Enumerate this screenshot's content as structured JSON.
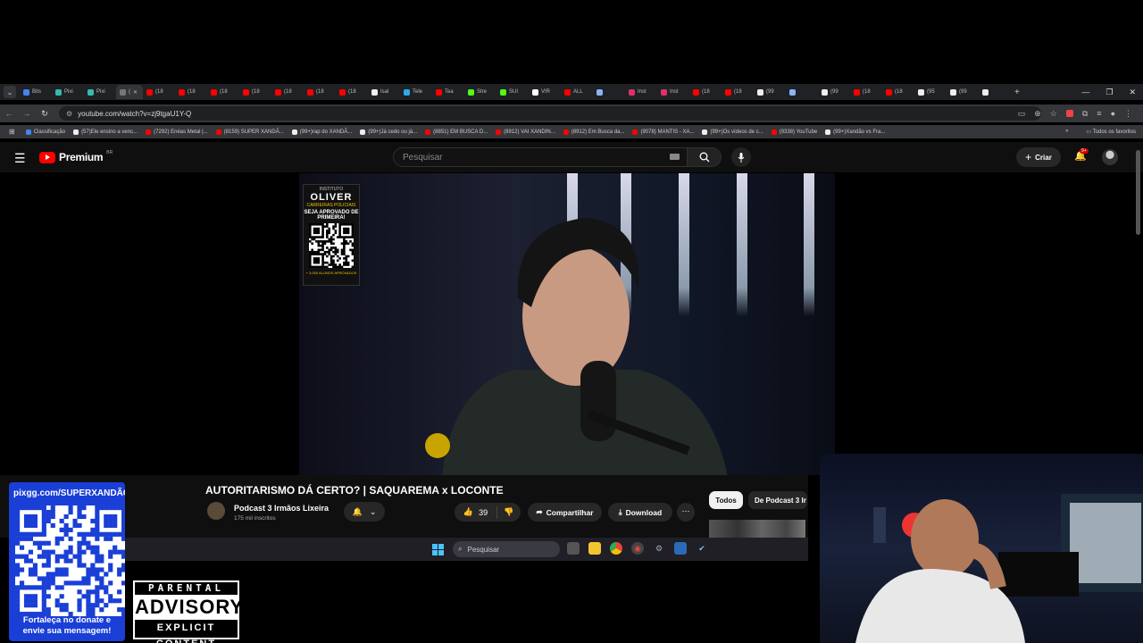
{
  "browser": {
    "tabs": [
      {
        "label": "Bits",
        "color": "#4285f4"
      },
      {
        "label": "Pixi",
        "color": "#32bcad"
      },
      {
        "label": "Pixi",
        "color": "#32bcad"
      },
      {
        "label": "(",
        "color": "#777777",
        "active": true
      },
      {
        "label": "(18",
        "color": "#ff0000"
      },
      {
        "label": "(18",
        "color": "#ff0000"
      },
      {
        "label": "(18",
        "color": "#ff0000"
      },
      {
        "label": "(18",
        "color": "#ff0000"
      },
      {
        "label": "(18",
        "color": "#ff0000"
      },
      {
        "label": "(18",
        "color": "#ff0000"
      },
      {
        "label": "(18",
        "color": "#ff0000"
      },
      {
        "label": "Isal",
        "color": "#eeeeee"
      },
      {
        "label": "Tele",
        "color": "#2aabee"
      },
      {
        "label": "Tea",
        "color": "#ff0000"
      },
      {
        "label": "Stre",
        "color": "#53fc18"
      },
      {
        "label": "SUI",
        "color": "#53fc18"
      },
      {
        "label": "VIR",
        "color": "#ffffff"
      },
      {
        "label": "ALL",
        "color": "#ff0000"
      },
      {
        "label": "",
        "color": "#8ab4f8"
      },
      {
        "label": "Inst",
        "color": "#e1306c"
      },
      {
        "label": "Inst",
        "color": "#e1306c"
      },
      {
        "label": "(18",
        "color": "#ff0000"
      },
      {
        "label": "(18",
        "color": "#ff0000"
      },
      {
        "label": "(99",
        "color": "#eeeeee"
      },
      {
        "label": "",
        "color": "#8ab4f8"
      },
      {
        "label": "(99",
        "color": "#eeeeee"
      },
      {
        "label": "(18",
        "color": "#ff0000"
      },
      {
        "label": "(18",
        "color": "#ff0000"
      },
      {
        "label": "(95",
        "color": "#eeeeee"
      },
      {
        "label": "(99",
        "color": "#eeeeee"
      },
      {
        "label": "",
        "color": "#eeeeee"
      }
    ],
    "url": "youtube.com/watch?v=zj9tgaU1Y-Q",
    "bookmarks": [
      {
        "label": "Classificação",
        "color": "#4285f4"
      },
      {
        "label": "(57)Ele ensino a venc...",
        "color": "#eeeeee"
      },
      {
        "label": "(7292) Enéas Metal |...",
        "color": "#ff0000"
      },
      {
        "label": "(8159) SUPER XANDÃ...",
        "color": "#ff0000"
      },
      {
        "label": "(99+)rap do XANDÃ...",
        "color": "#eeeeee"
      },
      {
        "label": "(99+)Já cedo ou já...",
        "color": "#eeeeee"
      },
      {
        "label": "(8851) EM BUSCA D...",
        "color": "#ff0000"
      },
      {
        "label": "(8912) VAI XANDIN...",
        "color": "#ff0000"
      },
      {
        "label": "(8912) Em Busca da...",
        "color": "#ff0000"
      },
      {
        "label": "(9078) MANTIS - XA...",
        "color": "#ff0000"
      },
      {
        "label": "(99+)Os vídeos de c...",
        "color": "#eeeeee"
      },
      {
        "label": "(9338) YouTube",
        "color": "#ff0000"
      },
      {
        "label": "(99+)Xandão vs Fra...",
        "color": "#eeeeee"
      }
    ],
    "bookmarks_more": "»",
    "all_favorites": "Todos os favoritos"
  },
  "youtube": {
    "logo_text": "Premium",
    "logo_region": "BR",
    "search_placeholder": "Pesquisar",
    "create_label": "Criar",
    "notif_count": "9+",
    "video_overlay": {
      "line1": "INSTITUTO",
      "line2": "OLIVER",
      "line3": "CARREIRAS POLICIAIS",
      "line4": "SEJA APROVADO DE PRIMEIRA!",
      "line5": "+ 3.000 ALUNOS APROVADOS"
    },
    "video_title": "AUTORITARISMO DÁ CERTO? | SAQUAREMA x LOCONTE",
    "channel_name": "Podcast 3 Irmãos Lixeira",
    "channel_subs": "175 mil inscritos",
    "like_count": "39",
    "share_label": "Compartilhar",
    "download_label": "Download",
    "chip_all": "Todos",
    "chip_channel": "De Podcast 3 Ir"
  },
  "taskbar": {
    "search_placeholder": "Pesquisar"
  },
  "overlay": {
    "donate_url": "pixgg.com/SUPERXANDÃO",
    "donate_msg_1": "Fortaleça no donate e",
    "donate_msg_2": "envie sua mensagem!",
    "advisory_top": "PARENTAL",
    "advisory_mid": "ADVISORY",
    "advisory_bottom": "EXPLICIT CONTENT"
  }
}
